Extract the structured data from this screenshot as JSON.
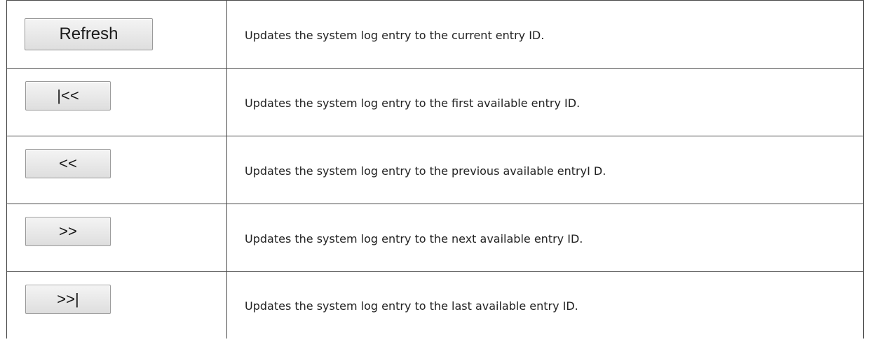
{
  "rows": [
    {
      "button": "Refresh",
      "description": "Updates the system log entry to the current entry ID."
    },
    {
      "button": "|<<",
      "description": "Updates the system log entry to the first available entry  ID."
    },
    {
      "button": "<<",
      "description": "Updates the system log entry to the previous available entryI D."
    },
    {
      "button": ">>",
      "description": "Updates the system log entry to the next available entry  ID."
    },
    {
      "button": ">>|",
      "description": "Updates the system log entry to the last available entry ID."
    }
  ]
}
